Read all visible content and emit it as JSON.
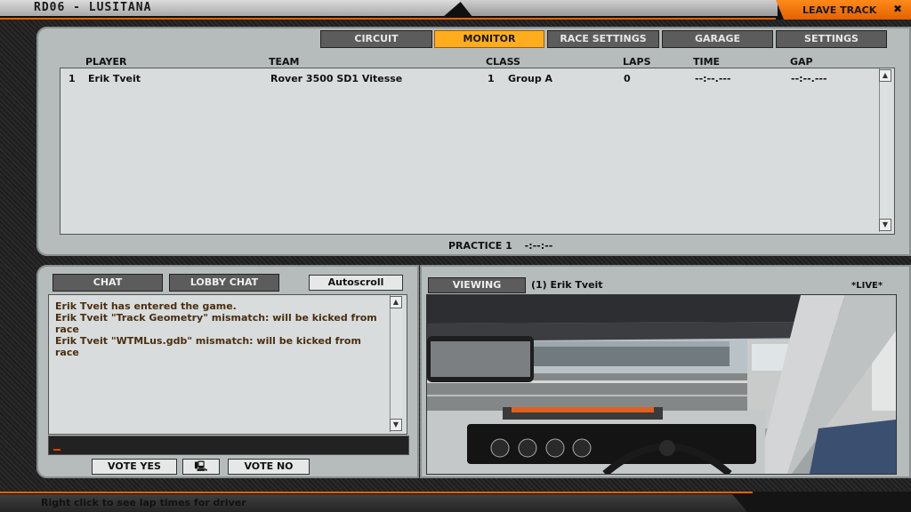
{
  "window": {
    "title": "RD06 - LUSITANA",
    "leave_track_label": "LEAVE TRACK"
  },
  "tabs": [
    {
      "label": "CIRCUIT",
      "active": false
    },
    {
      "label": "MONITOR",
      "active": true
    },
    {
      "label": "RACE SETTINGS",
      "active": false
    },
    {
      "label": "GARAGE",
      "active": false
    },
    {
      "label": "SETTINGS",
      "active": false
    }
  ],
  "standings": {
    "columns": [
      "PLAYER",
      "TEAM",
      "CLASS",
      "LAPS",
      "TIME",
      "GAP"
    ],
    "rows": [
      {
        "pos": "1",
        "player": "Erik Tveit",
        "team": "Rover 3500 SD1 Vitesse",
        "class_num": "1",
        "class_name": "Group A",
        "laps": "0",
        "time": "--:--.---",
        "gap": "--:--.---"
      }
    ],
    "session_label": "PRACTICE 1",
    "session_time": "-:--:--"
  },
  "chat": {
    "tabs": [
      "CHAT",
      "LOBBY CHAT"
    ],
    "autoscroll_label": "Autoscroll",
    "messages": [
      "Erik Tveit has entered the game.",
      "Erik Tveit \"Track Geometry\" mismatch: will be kicked from race",
      "Erik Tveit \"WTMLus.gdb\" mismatch: will be kicked from race"
    ],
    "vote_yes_label": "VOTE YES",
    "vote_no_label": "VOTE NO"
  },
  "viewer": {
    "viewing_label": "VIEWING",
    "driver": "(1) Erik Tveit",
    "live_label": "*LIVE*"
  },
  "status": {
    "hint": "Right click to see lap times for driver"
  },
  "colors": {
    "accent": "#ff8a1a",
    "panel": "#b6bcbc"
  }
}
